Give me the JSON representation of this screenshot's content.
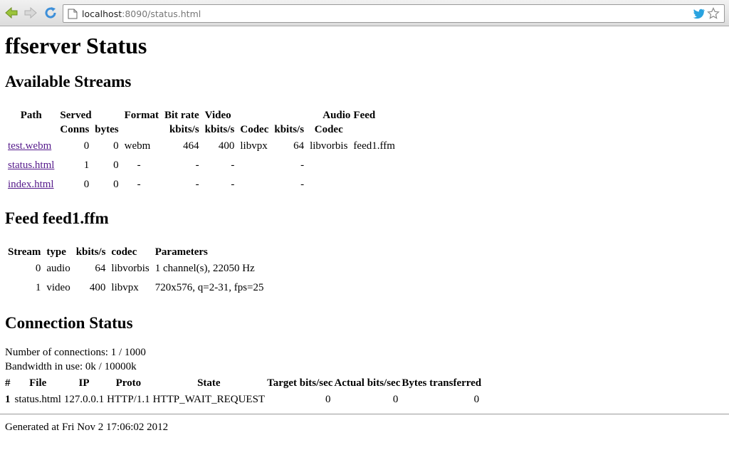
{
  "browser": {
    "url_host": "localhost",
    "url_rest": ":8090/status.html"
  },
  "page": {
    "title": "ffserver Status",
    "streams_heading": "Available Streams",
    "streams_headers": {
      "path": "Path",
      "served": "Served",
      "conns": "Conns",
      "bytes": "bytes",
      "format": "Format",
      "bitrate": "Bit rate",
      "bitrate_unit": "kbits/s",
      "video": "Video",
      "video_unit": "kbits/s",
      "codec": "Codec",
      "audio": "Audio",
      "audio_unit": "kbits/s",
      "audio_codec": "Codec",
      "feed": "Feed"
    },
    "streams": [
      {
        "path": "test.webm",
        "conns": "0",
        "bytes": "0",
        "format": "webm",
        "bitrate": "464",
        "video": "400",
        "codec": "libvpx",
        "audio": "64",
        "audio_codec": "libvorbis",
        "feed": "feed1.ffm"
      },
      {
        "path": "status.html",
        "conns": "1",
        "bytes": "0",
        "format": "-",
        "bitrate": "-",
        "video": "-",
        "codec": "",
        "audio": "-",
        "audio_codec": "",
        "feed": ""
      },
      {
        "path": "index.html",
        "conns": "0",
        "bytes": "0",
        "format": "-",
        "bitrate": "-",
        "video": "-",
        "codec": "",
        "audio": "-",
        "audio_codec": "",
        "feed": ""
      }
    ],
    "feed_heading": "Feed feed1.ffm",
    "feed_headers": {
      "stream": "Stream",
      "type": "type",
      "kbits": "kbits/s",
      "codec": "codec",
      "params": "Parameters"
    },
    "feed_rows": [
      {
        "stream": "0",
        "type": "audio",
        "kbits": "64",
        "codec": "libvorbis",
        "params": "1 channel(s), 22050 Hz"
      },
      {
        "stream": "1",
        "type": "video",
        "kbits": "400",
        "codec": "libvpx",
        "params": "720x576, q=2-31, fps=25"
      }
    ],
    "conn_heading": "Connection Status",
    "num_connections": "Number of connections: 1 / 1000",
    "bandwidth": "Bandwidth in use: 0k / 10000k",
    "conn_headers": {
      "num": "#",
      "file": "File",
      "ip": "IP",
      "proto": "Proto",
      "state": "State",
      "target": "Target bits/sec",
      "actual": "Actual bits/sec",
      "transferred": "Bytes transferred"
    },
    "conn_rows": [
      {
        "num": "1",
        "file": "status.html",
        "ip": "127.0.0.1",
        "proto": "HTTP/1.1",
        "state": "HTTP_WAIT_REQUEST",
        "target": "0",
        "actual": "0",
        "transferred": "0"
      }
    ],
    "footer": "Generated at Fri Nov 2 17:06:02 2012"
  }
}
